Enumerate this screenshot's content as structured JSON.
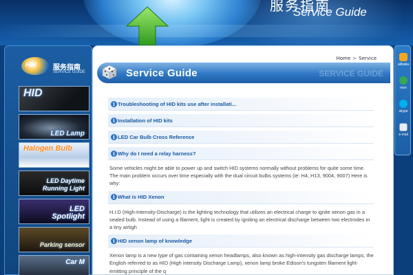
{
  "banner": {
    "title_cn": "服务指南",
    "title_en": "Service Guide"
  },
  "sidebar": {
    "logo_text": "HDI",
    "title_cn": "服务指南",
    "title_en": "SERVICE GUIDE",
    "items": [
      {
        "label": "HID"
      },
      {
        "label": "LED Lamp"
      },
      {
        "label": "Halogen Bulb"
      },
      {
        "label": "LED Daytime\nRunning Light"
      },
      {
        "label": "LED\nSpotlight"
      },
      {
        "label": "Parking sensor"
      },
      {
        "label": "Car M"
      }
    ]
  },
  "breadcrumb": {
    "home": "Home",
    "separator": ">",
    "current": "Service"
  },
  "heading": {
    "title": "Service Guide",
    "ghost": "SERVICE GUIDE"
  },
  "topics": [
    {
      "title": "Troubleshooting of HID kits use after installati..."
    },
    {
      "title": "Installation of HID kits"
    },
    {
      "title": "LED Car Bulb Cross Reference"
    },
    {
      "title": "Why do I need a relay harness?",
      "body": "Some vehicles might be able to power up and switch HID systems normally without problems for quite some time. The main problem occurs over time especially with the dual circuit bulbs systems (ie: H4, H13, 9004, 9007)   Here is why:"
    },
    {
      "title": "What is HID Xenon",
      "body": "H.I.D (High-Intensity-Discharge) is the lighting technology that utilizes an electrical charge to ignite xenon gas in a sealed bulb. Instead of using a filament, light is created by igniting an electrical discharge between two electrodes in a tiny airtigh"
    },
    {
      "title": "HID xenon lamp of knowledge",
      "body": "Xenon lamp is a new type of gas containing xenon headlamps, also known as high-intensity gas discharge lamps, the English referred to as HID (High intensity Discharge Lamp), xenon lamp broke Edison's tungsten filament light-emitting principle of the q"
    }
  ],
  "rightbar": {
    "items": [
      {
        "label": "alibaba",
        "icon": "alibaba-icon",
        "color": "#f5a623"
      },
      {
        "label": "msn",
        "icon": "msn-icon",
        "color": "#34a853"
      },
      {
        "label": "skype",
        "icon": "skype-icon",
        "color": "#00aff0"
      },
      {
        "label": "e-mail",
        "icon": "email-icon",
        "color": "#e8eef6"
      }
    ]
  },
  "colors": {
    "page_bg": "#0b3f7c",
    "heading_bar": "#2f77c4",
    "topic_link": "#1a59a3",
    "body_text": "#444444"
  }
}
